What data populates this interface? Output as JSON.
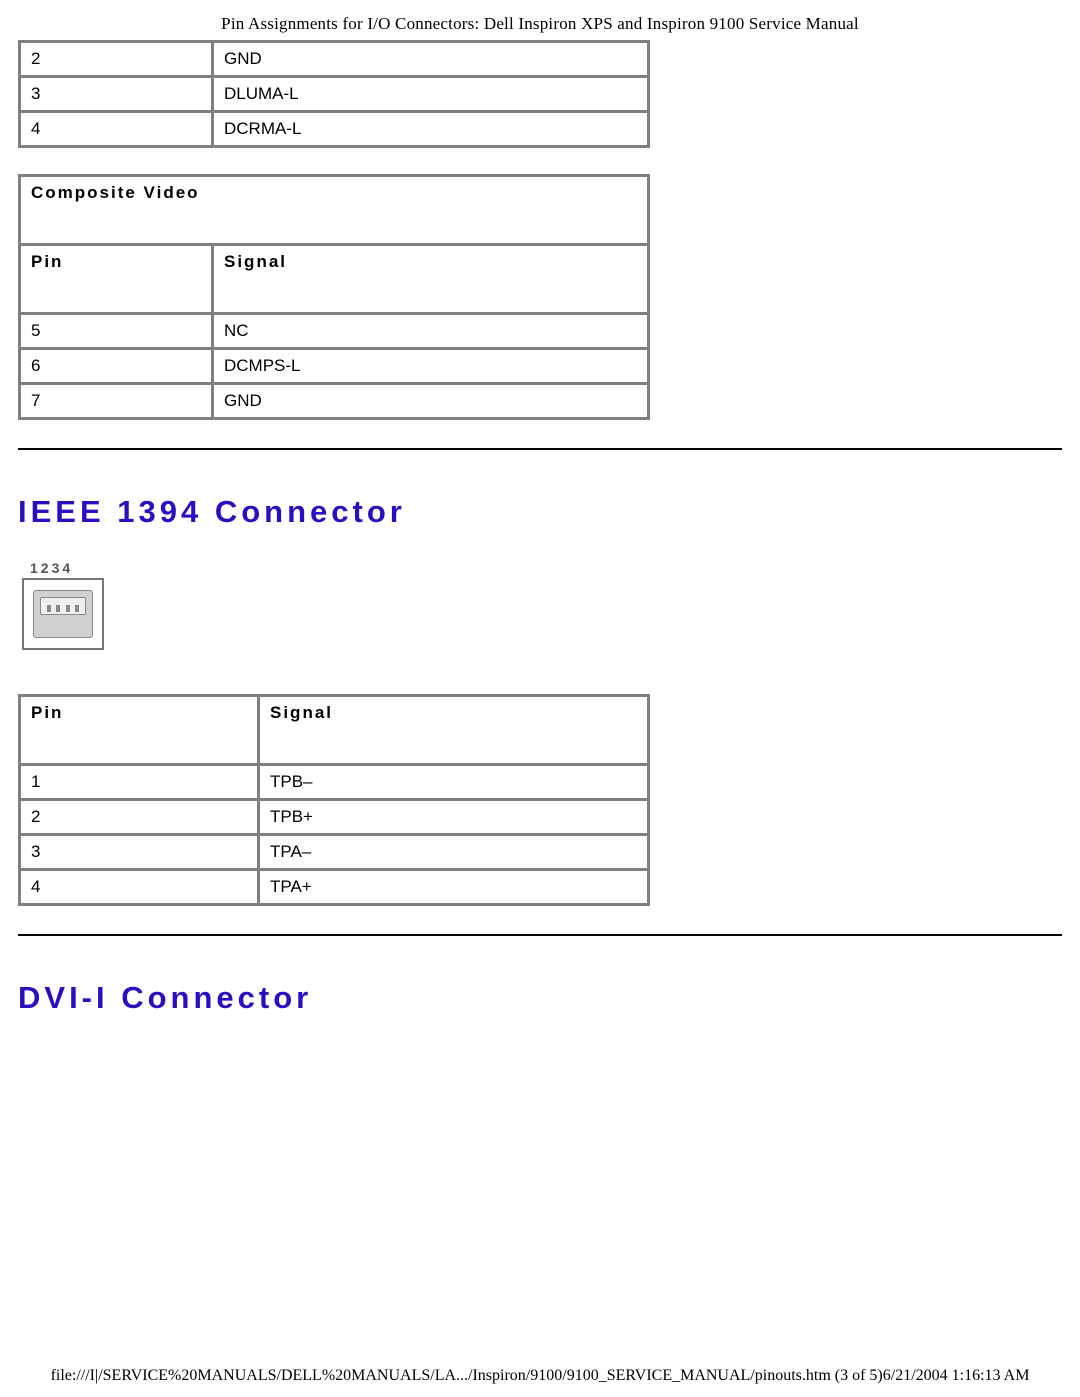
{
  "header": {
    "title": "Pin Assignments for I/O Connectors: Dell Inspiron XPS and Inspiron 9100 Service Manual"
  },
  "svideo_table": {
    "rows": [
      {
        "pin": "2",
        "signal": "GND"
      },
      {
        "pin": "3",
        "signal": "DLUMA-L"
      },
      {
        "pin": "4",
        "signal": "DCRMA-L"
      }
    ]
  },
  "composite_table": {
    "section_label": "Composite Video",
    "col_pin": "Pin",
    "col_signal": "Signal",
    "rows": [
      {
        "pin": "5",
        "signal": "NC"
      },
      {
        "pin": "6",
        "signal": "DCMPS-L"
      },
      {
        "pin": "7",
        "signal": "GND"
      }
    ]
  },
  "ieee1394": {
    "heading": "IEEE 1394 Connector",
    "diagram_label": "1234",
    "col_pin": "Pin",
    "col_signal": "Signal",
    "rows": [
      {
        "pin": "1",
        "signal": "TPB–"
      },
      {
        "pin": "2",
        "signal": "TPB+"
      },
      {
        "pin": "3",
        "signal": "TPA–"
      },
      {
        "pin": "4",
        "signal": "TPA+"
      }
    ]
  },
  "dvi": {
    "heading": "DVI-I Connector"
  },
  "footer": {
    "text": "file:///I|/SERVICE%20MANUALS/DELL%20MANUALS/LA.../Inspiron/9100/9100_SERVICE_MANUAL/pinouts.htm (3 of 5)6/21/2004 1:16:13 AM"
  }
}
